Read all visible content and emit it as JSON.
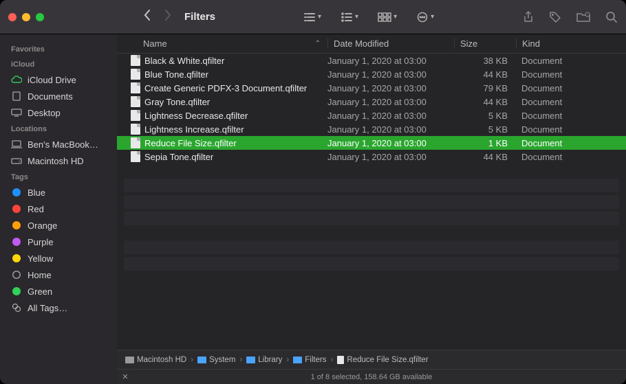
{
  "window_title": "Filters",
  "sidebar": {
    "sections": [
      {
        "label": "Favorites",
        "items": []
      },
      {
        "label": "iCloud",
        "items": [
          {
            "label": "iCloud Drive",
            "icon": "cloud-icon"
          },
          {
            "label": "Documents",
            "icon": "doc-icon"
          },
          {
            "label": "Desktop",
            "icon": "desktop-icon"
          }
        ]
      },
      {
        "label": "Locations",
        "items": [
          {
            "label": "Ben's MacBook…",
            "icon": "laptop-icon"
          },
          {
            "label": "Macintosh HD",
            "icon": "disk-icon"
          }
        ]
      },
      {
        "label": "Tags",
        "items": [
          {
            "label": "Blue",
            "icon": "tag-dot",
            "color": "#1e90ff"
          },
          {
            "label": "Red",
            "icon": "tag-dot",
            "color": "#ff453a"
          },
          {
            "label": "Orange",
            "icon": "tag-dot",
            "color": "#ff9f0a"
          },
          {
            "label": "Purple",
            "icon": "tag-dot",
            "color": "#bf5af2"
          },
          {
            "label": "Yellow",
            "icon": "tag-dot",
            "color": "#ffd60a"
          },
          {
            "label": "Home",
            "icon": "tag-dot",
            "color": "transparent",
            "stroke": "#9a9a9a"
          },
          {
            "label": "Green",
            "icon": "tag-dot",
            "color": "#30d158"
          },
          {
            "label": "All Tags…",
            "icon": "alltags-icon"
          }
        ]
      }
    ]
  },
  "columns": {
    "name": "Name",
    "date": "Date Modified",
    "size": "Size",
    "kind": "Kind"
  },
  "files": [
    {
      "name": "Black & White.qfilter",
      "date": "January 1, 2020 at 03:00",
      "size": "38 KB",
      "kind": "Document",
      "selected": false
    },
    {
      "name": "Blue Tone.qfilter",
      "date": "January 1, 2020 at 03:00",
      "size": "44 KB",
      "kind": "Document",
      "selected": false
    },
    {
      "name": "Create Generic PDFX-3 Document.qfilter",
      "date": "January 1, 2020 at 03:00",
      "size": "79 KB",
      "kind": "Document",
      "selected": false
    },
    {
      "name": "Gray Tone.qfilter",
      "date": "January 1, 2020 at 03:00",
      "size": "44 KB",
      "kind": "Document",
      "selected": false
    },
    {
      "name": "Lightness Decrease.qfilter",
      "date": "January 1, 2020 at 03:00",
      "size": "5 KB",
      "kind": "Document",
      "selected": false
    },
    {
      "name": "Lightness Increase.qfilter",
      "date": "January 1, 2020 at 03:00",
      "size": "5 KB",
      "kind": "Document",
      "selected": false
    },
    {
      "name": "Reduce File Size.qfilter",
      "date": "January 1, 2020 at 03:00",
      "size": "1 KB",
      "kind": "Document",
      "selected": true
    },
    {
      "name": "Sepia Tone.qfilter",
      "date": "January 1, 2020 at 03:00",
      "size": "44 KB",
      "kind": "Document",
      "selected": false
    }
  ],
  "pathbar": [
    {
      "label": "Macintosh HD",
      "icon": "disk"
    },
    {
      "label": "System",
      "icon": "folder"
    },
    {
      "label": "Library",
      "icon": "folder"
    },
    {
      "label": "Filters",
      "icon": "folder"
    },
    {
      "label": "Reduce File Size.qfilter",
      "icon": "file"
    }
  ],
  "status": "1 of 8 selected, 158.64 GB available"
}
